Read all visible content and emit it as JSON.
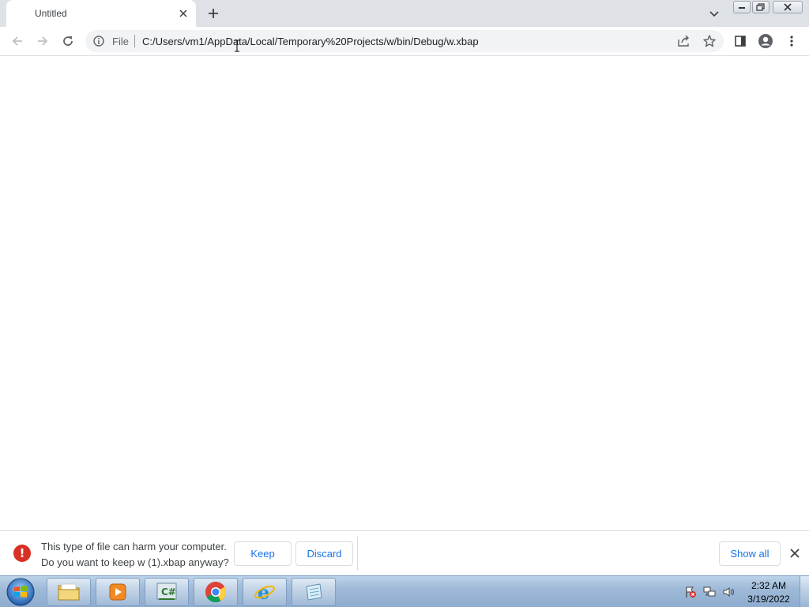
{
  "browser": {
    "tab": {
      "title": "Untitled",
      "close_icon": "close-icon"
    },
    "new_tab_icon": "plus-icon",
    "tab_search_icon": "chevron-down-icon",
    "window_controls": [
      "minimize",
      "restore",
      "close"
    ]
  },
  "toolbar": {
    "back_icon": "arrow-left-icon",
    "forward_icon": "arrow-right-icon",
    "reload_icon": "reload-icon",
    "omnibox": {
      "scheme_label": "File",
      "url": "C:/Users/vm1/AppData/Local/Temporary%20Projects/w/bin/Debug/w.xbap"
    },
    "share_icon": "share-icon",
    "bookmark_icon": "star-icon",
    "side_panel_icon": "side-panel-icon",
    "profile_icon": "profile-icon",
    "menu_icon": "kebab-menu-icon"
  },
  "download_shelf": {
    "warning_line1": "This type of file can harm your computer.",
    "warning_line2": "Do you want to keep w (1).xbap anyway?",
    "keep_label": "Keep",
    "discard_label": "Discard",
    "show_all_label": "Show all"
  },
  "taskbar": {
    "apps": [
      "explorer",
      "media-player",
      "visual-csharp",
      "chrome",
      "internet-explorer",
      "notepad"
    ],
    "clock": {
      "time": "2:32 AM",
      "date": "3/19/2022"
    }
  },
  "colors": {
    "tabstrip": "#dee1e6",
    "omnibox": "#f1f3f4",
    "accent_blue": "#1a73e8",
    "warning_red": "#d93025",
    "taskbar": "#9fbad8"
  }
}
